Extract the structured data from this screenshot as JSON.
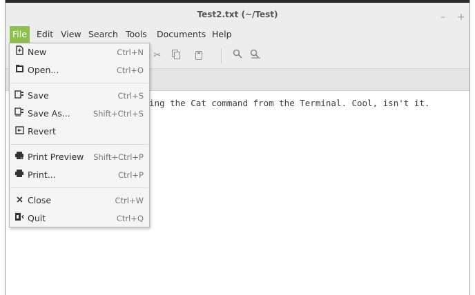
{
  "window": {
    "title": "Test2.txt (~/Test)",
    "minimize_label": "–",
    "maximize_label": "+"
  },
  "menubar": {
    "items": [
      "File",
      "Edit",
      "View",
      "Search",
      "Tools",
      "Documents",
      "Help"
    ]
  },
  "toolbar": {
    "icons": [
      "cut-icon",
      "copy-icon",
      "paste-icon",
      "search-icon",
      "search-replace-icon"
    ]
  },
  "editor": {
    "visible_text": "ing the Cat command from the Terminal. Cool, isn't it."
  },
  "file_menu": {
    "items": [
      {
        "label": "New",
        "shortcut": "Ctrl+N",
        "icon": "new-document-icon"
      },
      {
        "label": "Open...",
        "shortcut": "Ctrl+O",
        "icon": "open-document-icon"
      },
      {
        "label": "Save",
        "shortcut": "Ctrl+S",
        "icon": "save-icon"
      },
      {
        "label": "Save As...",
        "shortcut": "Shift+Ctrl+S",
        "icon": "save-as-icon"
      },
      {
        "label": "Revert",
        "shortcut": "",
        "icon": "revert-icon"
      },
      {
        "label": "Print Preview",
        "shortcut": "Shift+Ctrl+P",
        "icon": "print-preview-icon"
      },
      {
        "label": "Print...",
        "shortcut": "Ctrl+P",
        "icon": "print-icon"
      },
      {
        "label": "Close",
        "shortcut": "Ctrl+W",
        "icon": "close-icon"
      },
      {
        "label": "Quit",
        "shortcut": "Ctrl+Q",
        "icon": "quit-icon"
      }
    ]
  },
  "colors": {
    "menu_active": "#8fbf51",
    "chrome": "#ededed"
  }
}
